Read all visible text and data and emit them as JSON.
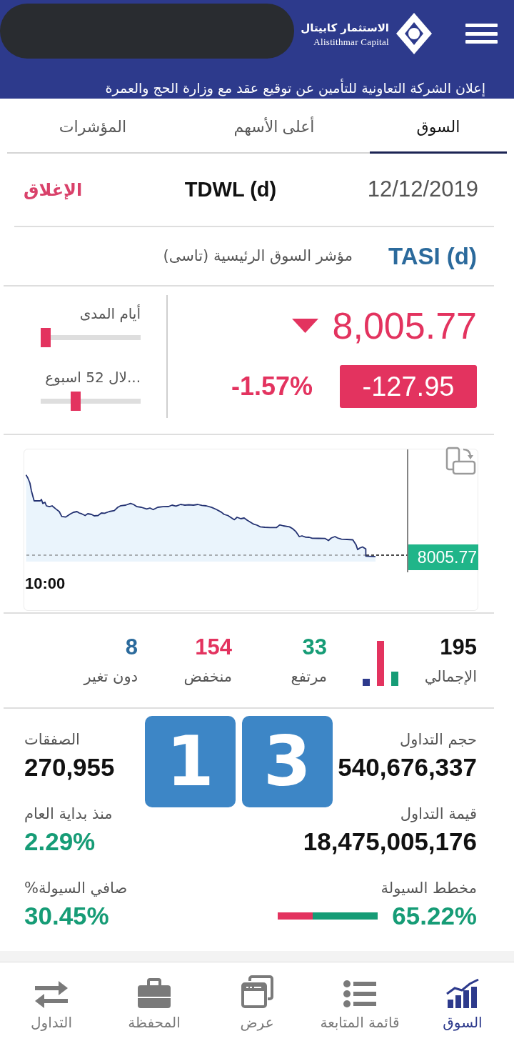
{
  "header": {
    "logo_name": "الاستثمار كابيتال",
    "logo_subtitle": "Alistithmar Capital",
    "ticker": "إعلان الشركة التعاونية للتأمين عن توقيع عقد مع وزارة الحج والعمرة"
  },
  "tabs": [
    {
      "label": "السوق",
      "selected": true
    },
    {
      "label": "أعلى الأسهم",
      "selected": false
    },
    {
      "label": "المؤشرات",
      "selected": false
    }
  ],
  "market": {
    "date": "12/12/2019",
    "exchange": "TDWL (d)",
    "status": "الإغلاق"
  },
  "index": {
    "symbol": "TASI (d)",
    "name": "مؤشر السوق الرئيسية (تاسى)",
    "value": "8,005.77",
    "falling": true,
    "change": "-127.95",
    "change_percent": "-1.57%",
    "ranges": [
      {
        "label": "أيام المدى",
        "level": 0.05
      },
      {
        "label": "...لال 52 اسبوع",
        "level": 0.35
      }
    ]
  },
  "chart": {
    "time_label": "10:00",
    "last_price": "8005.77"
  },
  "breadth": [
    {
      "kind": "total",
      "value": "195",
      "label": "الإجمالي"
    },
    {
      "kind": "up",
      "value": "33",
      "label": "مرتفع"
    },
    {
      "kind": "down",
      "value": "154",
      "label": "منخفض"
    },
    {
      "kind": "unchanged",
      "value": "8",
      "label": "دون تغير"
    }
  ],
  "metrics": [
    {
      "kind": "count",
      "label": "حجم التداول",
      "value": "540,676,337"
    },
    {
      "kind": "count",
      "label": "الصفقات",
      "value": "270,955"
    },
    {
      "kind": "count",
      "label": "قيمة التداول",
      "value": "18,475,005,176"
    },
    {
      "kind": "gain",
      "label": "منذ بداية العام",
      "value": "2.29%"
    },
    {
      "kind": "bar",
      "label": "مخطط السيولة",
      "value": "65.22%",
      "level": 0.65
    },
    {
      "kind": "gain",
      "label": "صافي السيولة%",
      "value": "30.45%"
    }
  ],
  "overlay_tiles": [
    "3",
    "1"
  ],
  "nav": [
    {
      "label": "السوق",
      "selected": true
    },
    {
      "label": "قائمة المتابعة",
      "selected": false
    },
    {
      "label": "عرض",
      "selected": false
    },
    {
      "label": "المحفظة",
      "selected": false
    },
    {
      "label": "التداول",
      "selected": false
    }
  ]
}
